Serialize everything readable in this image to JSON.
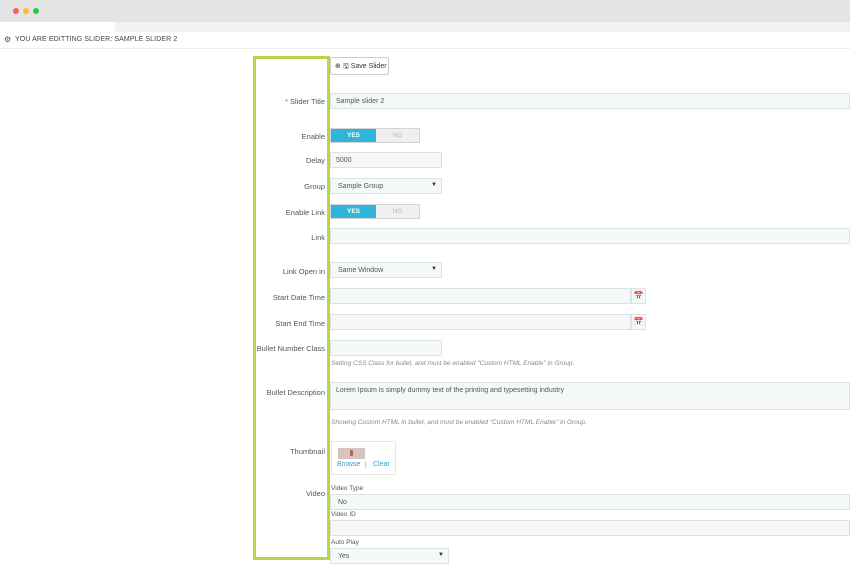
{
  "chrome": {
    "dots": [
      "#ff5f57",
      "#febc2e",
      "#28c840"
    ]
  },
  "header": {
    "editing_title": "YOU ARE EDITTING SLIDER: SAMPLE SLIDER 2"
  },
  "toolbar": {
    "save_label": "Save Slider"
  },
  "form": {
    "slider_title": {
      "label": "Slider Title",
      "required_mark": "*",
      "value": "Sample slider 2"
    },
    "enable": {
      "label": "Enable",
      "yes": "YES",
      "no": "NO"
    },
    "delay": {
      "label": "Delay",
      "value": "5000"
    },
    "group": {
      "label": "Group",
      "value": "Sample Group"
    },
    "enable_link": {
      "label": "Enable Link",
      "yes": "YES",
      "no": "NO"
    },
    "link": {
      "label": "Link",
      "value": ""
    },
    "link_open_in": {
      "label": "Link Open in",
      "value": "Same Window"
    },
    "start_date_time": {
      "label": "Start Date Time",
      "value": ""
    },
    "start_end_time": {
      "label": "Start End Time",
      "value": ""
    },
    "bullet_number_class": {
      "label": "Bullet Number Class",
      "value": "",
      "help": "Setting CSS Class for bullet, and must be enabled \"Custom HTML Enable\" in Group."
    },
    "bullet_description": {
      "label": "Bullet Description",
      "value": "Lorem Ipsum is simply dummy text of the printing and typesetting industry",
      "help": "Showing Custom HTML in bullet, and must be enabled \"Custom HTML Enable\" in Group."
    },
    "thumbnail": {
      "label": "Thumbnail",
      "browse": "Browse",
      "separator": "|",
      "clear": "Clear"
    },
    "video": {
      "label": "Video",
      "type_label": "Video Type",
      "type_value": "No",
      "id_label": "Video ID",
      "id_value": "",
      "autoplay_label": "Auto Play",
      "autoplay_value": "Yes"
    }
  }
}
